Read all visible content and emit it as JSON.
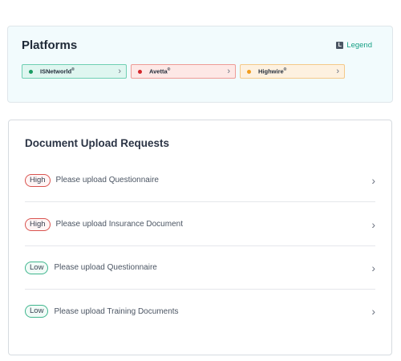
{
  "platforms": {
    "title": "Platforms",
    "legend_label": "Legend",
    "legend_icon_letter": "L",
    "items": [
      {
        "name": "ISNetworld",
        "mark": "®",
        "dot_color": "#1a9b62",
        "bg": "#dff6f0",
        "border": "#6fcfb2"
      },
      {
        "name": "Avetta",
        "mark": "®",
        "dot_color": "#d3262b",
        "bg": "#fde8e6",
        "border": "#ee9b96"
      },
      {
        "name": "Highwire",
        "mark": "®",
        "dot_color": "#f29d1d",
        "bg": "#fdf1e0",
        "border": "#f4c989"
      }
    ]
  },
  "documents": {
    "title": "Document Upload Requests",
    "requests": [
      {
        "priority": "High",
        "label": "Please upload Questionnaire",
        "badge_border": "#d9534f",
        "badge_bg": "#fff5f5"
      },
      {
        "priority": "High",
        "label": "Please upload Insurance Document",
        "badge_border": "#d9534f",
        "badge_bg": "#fff5f5"
      },
      {
        "priority": "Low",
        "label": "Please upload Questionnaire",
        "badge_border": "#3fb68e",
        "badge_bg": "#f1fbf7"
      },
      {
        "priority": "Low",
        "label": "Please upload Training Documents",
        "badge_border": "#3fb68e",
        "badge_bg": "#f1fbf7"
      }
    ]
  }
}
